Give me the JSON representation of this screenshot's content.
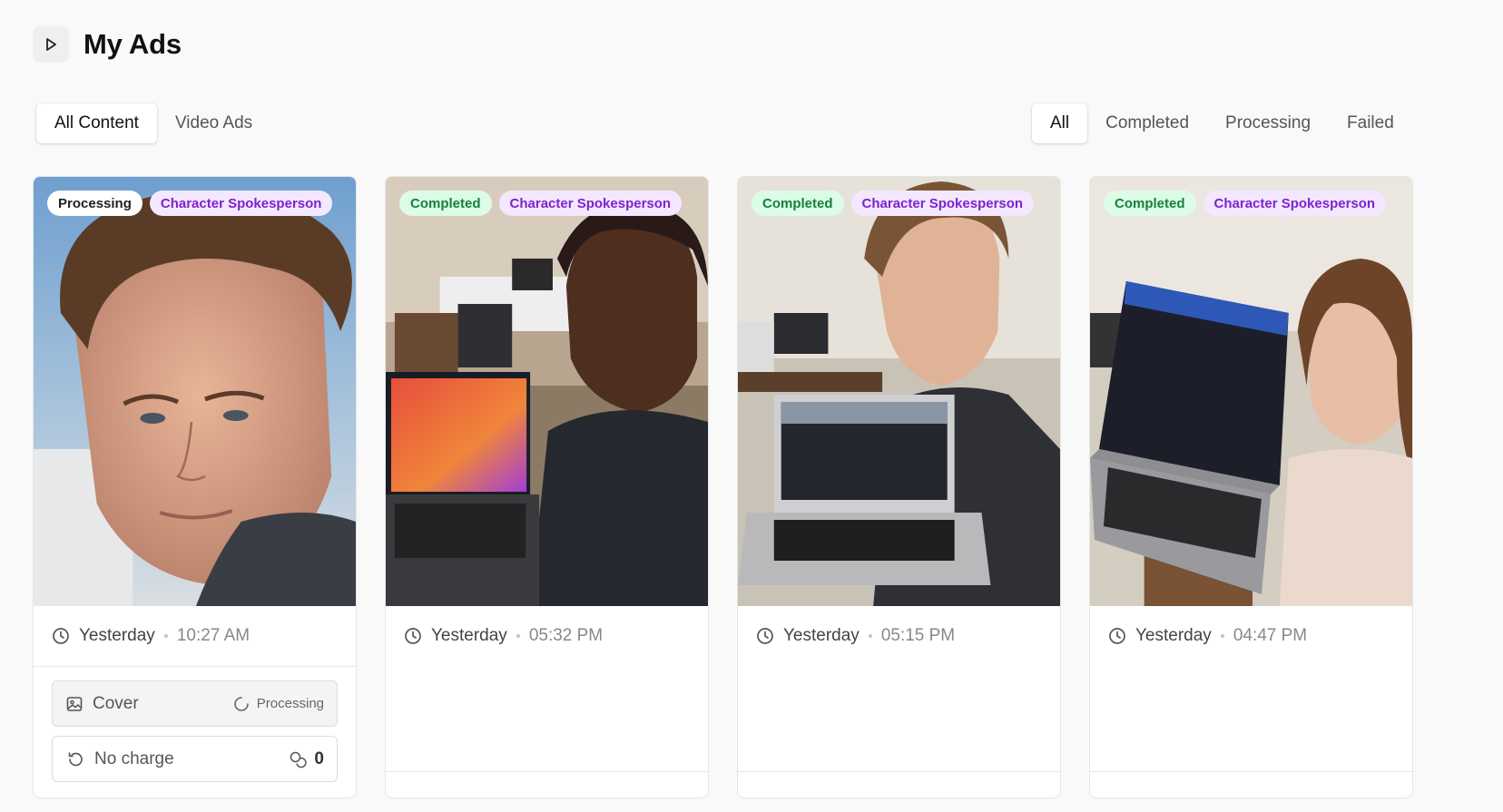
{
  "header": {
    "title": "My Ads",
    "toggle_icon": "play-icon"
  },
  "content_tabs": [
    {
      "label": "All Content",
      "active": true
    },
    {
      "label": "Video Ads",
      "active": false
    }
  ],
  "status_filters": [
    {
      "label": "All",
      "active": true
    },
    {
      "label": "Completed",
      "active": false
    },
    {
      "label": "Processing",
      "active": false
    },
    {
      "label": "Failed",
      "active": false
    }
  ],
  "colors": {
    "completed_badge_bg": "#dcfce7",
    "completed_badge_text": "#15803d",
    "type_badge_bg": "#f3e8ff",
    "type_badge_text": "#7e22ce"
  },
  "cards": [
    {
      "status": "Processing",
      "type": "Character Spokesperson",
      "day": "Yesterday",
      "time": "10:27 AM",
      "cover_label": "Cover",
      "cover_status": "Processing",
      "charge_label": "No charge",
      "credit_count": "0"
    },
    {
      "status": "Completed",
      "type": "Character Spokesperson",
      "day": "Yesterday",
      "time": "05:32 PM"
    },
    {
      "status": "Completed",
      "type": "Character Spokesperson",
      "day": "Yesterday",
      "time": "05:15 PM"
    },
    {
      "status": "Completed",
      "type": "Character Spokesperson",
      "day": "Yesterday",
      "time": "04:47 PM"
    }
  ]
}
